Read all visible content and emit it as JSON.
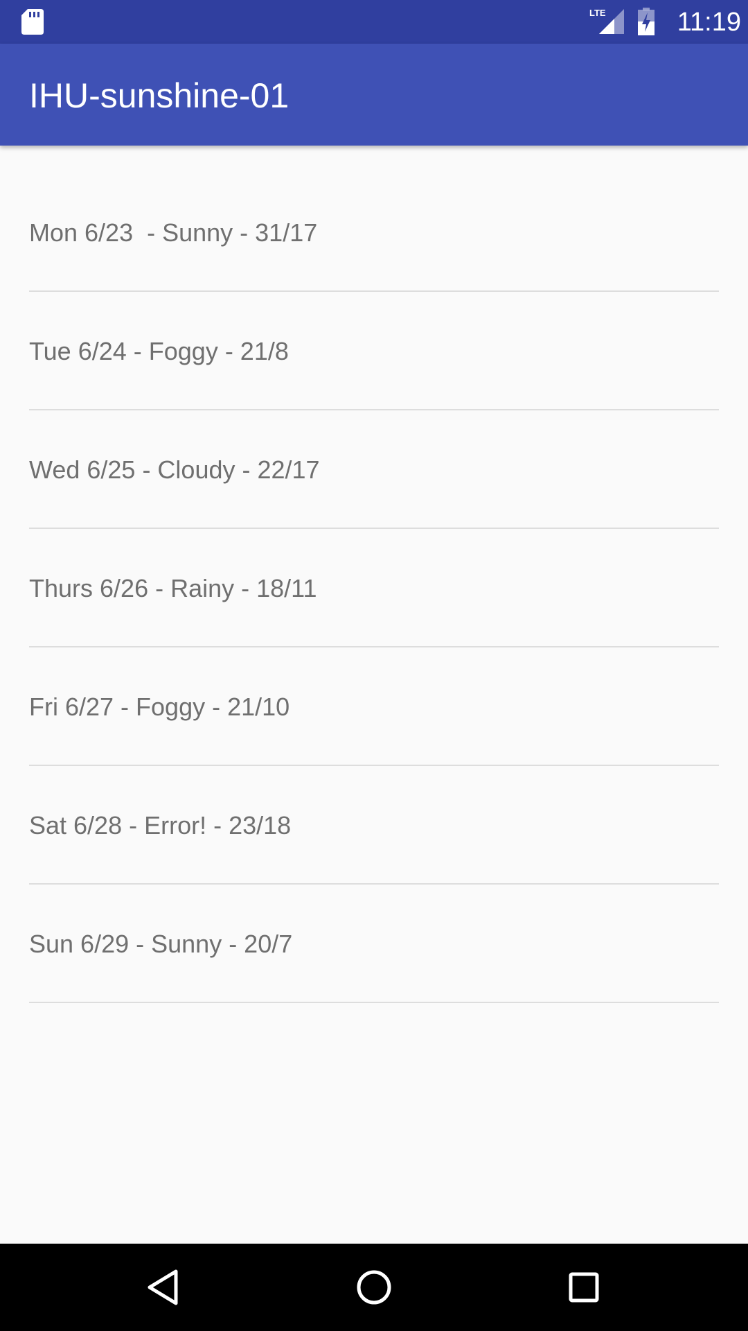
{
  "status_bar": {
    "time": "11:19",
    "network_label": "LTE",
    "icons": [
      "sd-card-icon",
      "lte-signal-icon",
      "battery-charging-icon"
    ]
  },
  "app_bar": {
    "title": "IHU-sunshine-01"
  },
  "forecast": {
    "items": [
      "Mon 6/23  - Sunny - 31/17",
      "Tue 6/24 - Foggy - 21/8",
      "Wed 6/25 - Cloudy - 22/17",
      "Thurs 6/26 - Rainy - 18/11",
      "Fri 6/27 - Foggy - 21/10",
      "Sat 6/28 - Error! - 23/18",
      "Sun 6/29 - Sunny - 20/7"
    ]
  },
  "nav_bar": {
    "icons": [
      "back-icon",
      "home-icon",
      "recents-icon"
    ]
  },
  "colors": {
    "status_bar": "#303f9f",
    "app_bar": "#3f51b5",
    "background": "#fafafa",
    "item_text": "#6f6f6f",
    "divider": "#dddddd"
  }
}
